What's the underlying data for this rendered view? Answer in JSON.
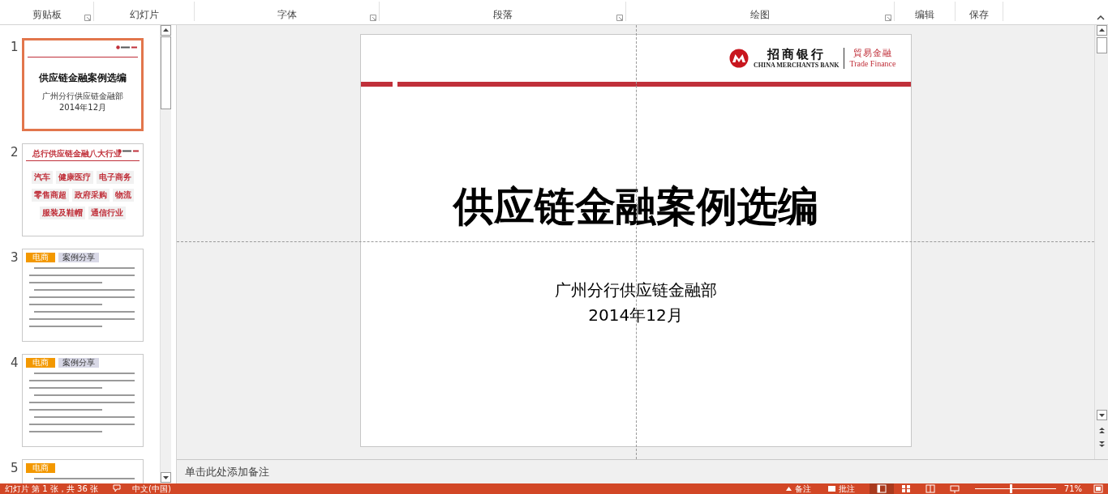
{
  "ribbon": {
    "groups": [
      {
        "label": "剪贴板",
        "launcher": true
      },
      {
        "label": "幻灯片",
        "launcher": false
      },
      {
        "label": "字体",
        "launcher": true
      },
      {
        "label": "段落",
        "launcher": true
      },
      {
        "label": "绘图",
        "launcher": true
      },
      {
        "label": "编辑",
        "launcher": false
      },
      {
        "label": "保存",
        "launcher": false
      }
    ]
  },
  "thumbnails": [
    {
      "number": "1",
      "selected": true,
      "kind": "title",
      "title": "供应链金融案例选编",
      "lines": [
        "广州分行供应链金融部",
        "2014年12月"
      ]
    },
    {
      "number": "2",
      "selected": false,
      "kind": "grid",
      "title": "总行供应链金融八大行业",
      "items": [
        "汽车",
        "健康医疗",
        "电子商务",
        "零售商超",
        "政府采购",
        "物流",
        "服装及鞋帽",
        "通信行业"
      ]
    },
    {
      "number": "3",
      "selected": false,
      "kind": "text",
      "tag": "电商",
      "section": "案例分享"
    },
    {
      "number": "4",
      "selected": false,
      "kind": "text",
      "tag": "电商",
      "section": "案例分享"
    },
    {
      "number": "5",
      "selected": false,
      "kind": "text",
      "tag": "电商"
    }
  ],
  "slide": {
    "logo": {
      "name": "招商银行",
      "english": "CHINA MERCHANTS BANK",
      "division": "貿易金融",
      "division_english": "Trade Finance"
    },
    "title": "供应链金融案例选编",
    "subtitle": [
      "广州分行供应链金融部",
      "2014年12月"
    ]
  },
  "notes": {
    "placeholder": "单击此处添加备注"
  },
  "status_bar": {
    "slide_info": "幻灯片 第 1 张，共 36 张",
    "language": "中文(中国)",
    "notes": "备注",
    "comments": "批注",
    "zoom": "71%",
    "zoom_slider": {
      "level": 0.45
    }
  }
}
